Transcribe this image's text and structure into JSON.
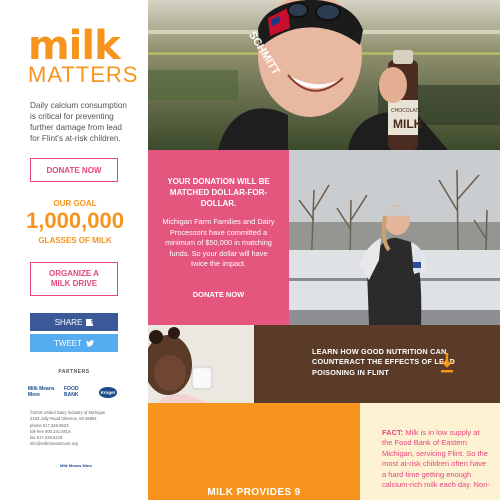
{
  "logo": {
    "line1": "milk",
    "line2": "MATTERS"
  },
  "sidebar": {
    "intro": "Daily calcium consumption is critical for preventing further damage from lead for Flint's at-risk children.",
    "donate_label": "DONATE NOW",
    "goal_label": "OUR GOAL",
    "goal_number": "1,000,000",
    "goal_unit": "GLASSES OF MILK",
    "organize_label_1": "ORGANIZE A",
    "organize_label_2": "MILK DRIVE",
    "share_label": "SHARE",
    "tweet_label": "TWEET",
    "partners_label": "PARTNERS",
    "partners": [
      "Milk Means More",
      "FOOD BANK",
      "Kroger"
    ],
    "contact": [
      "©2016 United Dairy Industry of Michigan",
      "2163 Jolly Road Okemos, MI 48864",
      "phone 517.349.8923",
      "toll-free 800.241.MILK",
      "fax 517.349.6218",
      "info@milkmeansmore.org"
    ],
    "footer_logo": "Milk Means More"
  },
  "hero": {
    "cap_text": "SCHMITT",
    "bottle_text_1": "CHOCOLATE",
    "bottle_text_2": "MILK"
  },
  "match": {
    "heading": "YOUR DONATION WILL BE MATCHED DOLLAR-FOR-DOLLAR.",
    "body": "Michigan Farm Families and Dairy Processors have committed a minimum of $50,000 in matching funds. So your dollar will have twice the impact.",
    "donate_label": "DONATE NOW"
  },
  "learn": {
    "text": "LEARN HOW GOOD NUTRITION CAN COUNTERACT THE EFFECTS OF LEAD POISONING IN FLINT"
  },
  "milk_provides": {
    "text": "MILK PROVIDES 9"
  },
  "fact": {
    "label": "FACT:",
    "body": " Milk is in low supply at the Food Bank of Eastern Michigan, servicing Flint. So the most at-risk children often have a hard time getting enough calcium-rich milk each day. Non-"
  },
  "colors": {
    "orange": "#f7941d",
    "pink": "#e4567e",
    "brown": "#5a3b28",
    "facebook": "#3b5998",
    "twitter": "#55acee",
    "fact_bg": "#fdf2d2"
  }
}
